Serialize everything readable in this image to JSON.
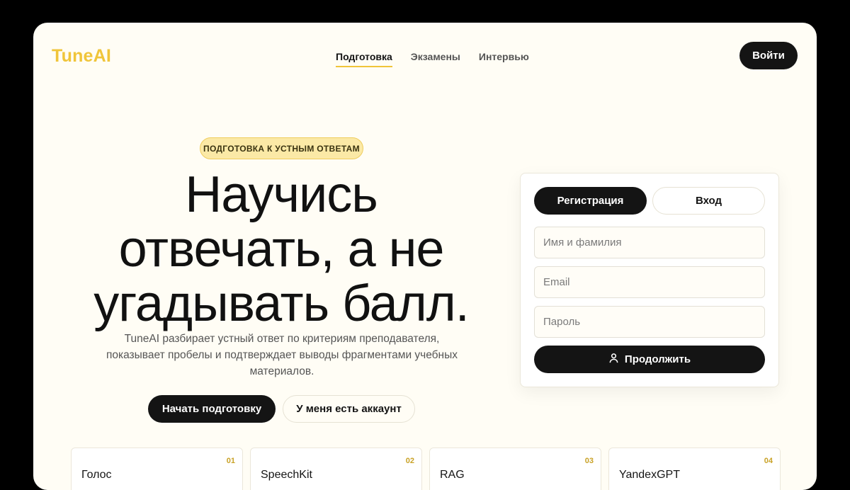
{
  "header": {
    "logo": "TuneAI",
    "nav": [
      {
        "label": "Подготовка",
        "active": true
      },
      {
        "label": "Экзамены",
        "active": false
      },
      {
        "label": "Интервью",
        "active": false
      }
    ],
    "login_label": "Войти"
  },
  "hero": {
    "badge": "ПОДГОТОВКА К УСТНЫМ ОТВЕТАМ",
    "headline": [
      "Научись",
      "отвечать, а не",
      "угадывать балл."
    ],
    "subtitle": "TuneAI разбирает устный ответ по критериям преподавателя, показывает пробелы и подтверждает выводы фрагментами учебных материалов.",
    "cta_primary": "Начать подготовку",
    "cta_secondary": "У меня есть аккаунт"
  },
  "form": {
    "tabs": [
      {
        "label": "Регистрация",
        "active": true
      },
      {
        "label": "Вход",
        "active": false
      }
    ],
    "fields": {
      "name_placeholder": "Имя и фамилия",
      "email_placeholder": "Email",
      "password_placeholder": "Пароль"
    },
    "submit_label": "Продолжить",
    "submit_icon": "user-icon"
  },
  "features": [
    {
      "num": "01",
      "title": "Голос"
    },
    {
      "num": "02",
      "title": "SpeechKit"
    },
    {
      "num": "03",
      "title": "RAG"
    },
    {
      "num": "04",
      "title": "YandexGPT"
    }
  ],
  "colors": {
    "accent": "#f0c53a",
    "background": "#fffdf5",
    "dark": "#141414"
  }
}
